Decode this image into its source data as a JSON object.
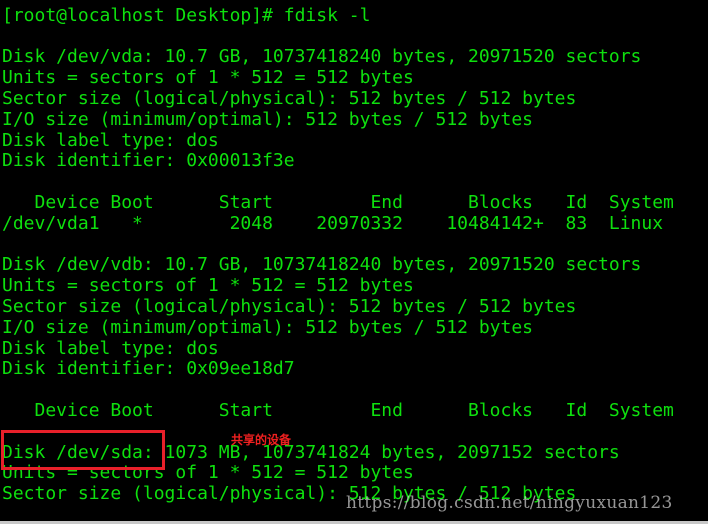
{
  "terminal": {
    "lines": [
      "",
      "[root@localhost Desktop]# fdisk -l",
      "",
      "Disk /dev/vda: 10.7 GB, 10737418240 bytes, 20971520 sectors",
      "Units = sectors of 1 * 512 = 512 bytes",
      "Sector size (logical/physical): 512 bytes / 512 bytes",
      "I/O size (minimum/optimal): 512 bytes / 512 bytes",
      "Disk label type: dos",
      "Disk identifier: 0x00013f3e",
      "",
      "   Device Boot      Start         End      Blocks   Id  System",
      "/dev/vda1   *        2048    20970332    10484142+  83  Linux",
      "",
      "Disk /dev/vdb: 10.7 GB, 10737418240 bytes, 20971520 sectors",
      "Units = sectors of 1 * 512 = 512 bytes",
      "Sector size (logical/physical): 512 bytes / 512 bytes",
      "I/O size (minimum/optimal): 512 bytes / 512 bytes",
      "Disk label type: dos",
      "Disk identifier: 0x09ee18d7",
      "",
      "   Device Boot      Start         End      Blocks   Id  System",
      "",
      "Disk /dev/sda: 1073 MB, 1073741824 bytes, 2097152 sectors",
      "Units = sectors of 1 * 512 = 512 bytes",
      "Sector size (logical/physical): 512 bytes / 512 bytes"
    ],
    "text_color": "#0ee00e",
    "background": "#000000"
  },
  "annotation": {
    "note": "共享的设备",
    "highlight_color": "#e8202a"
  },
  "watermark": "https://blog.csdn.net/ningyuxuan123"
}
